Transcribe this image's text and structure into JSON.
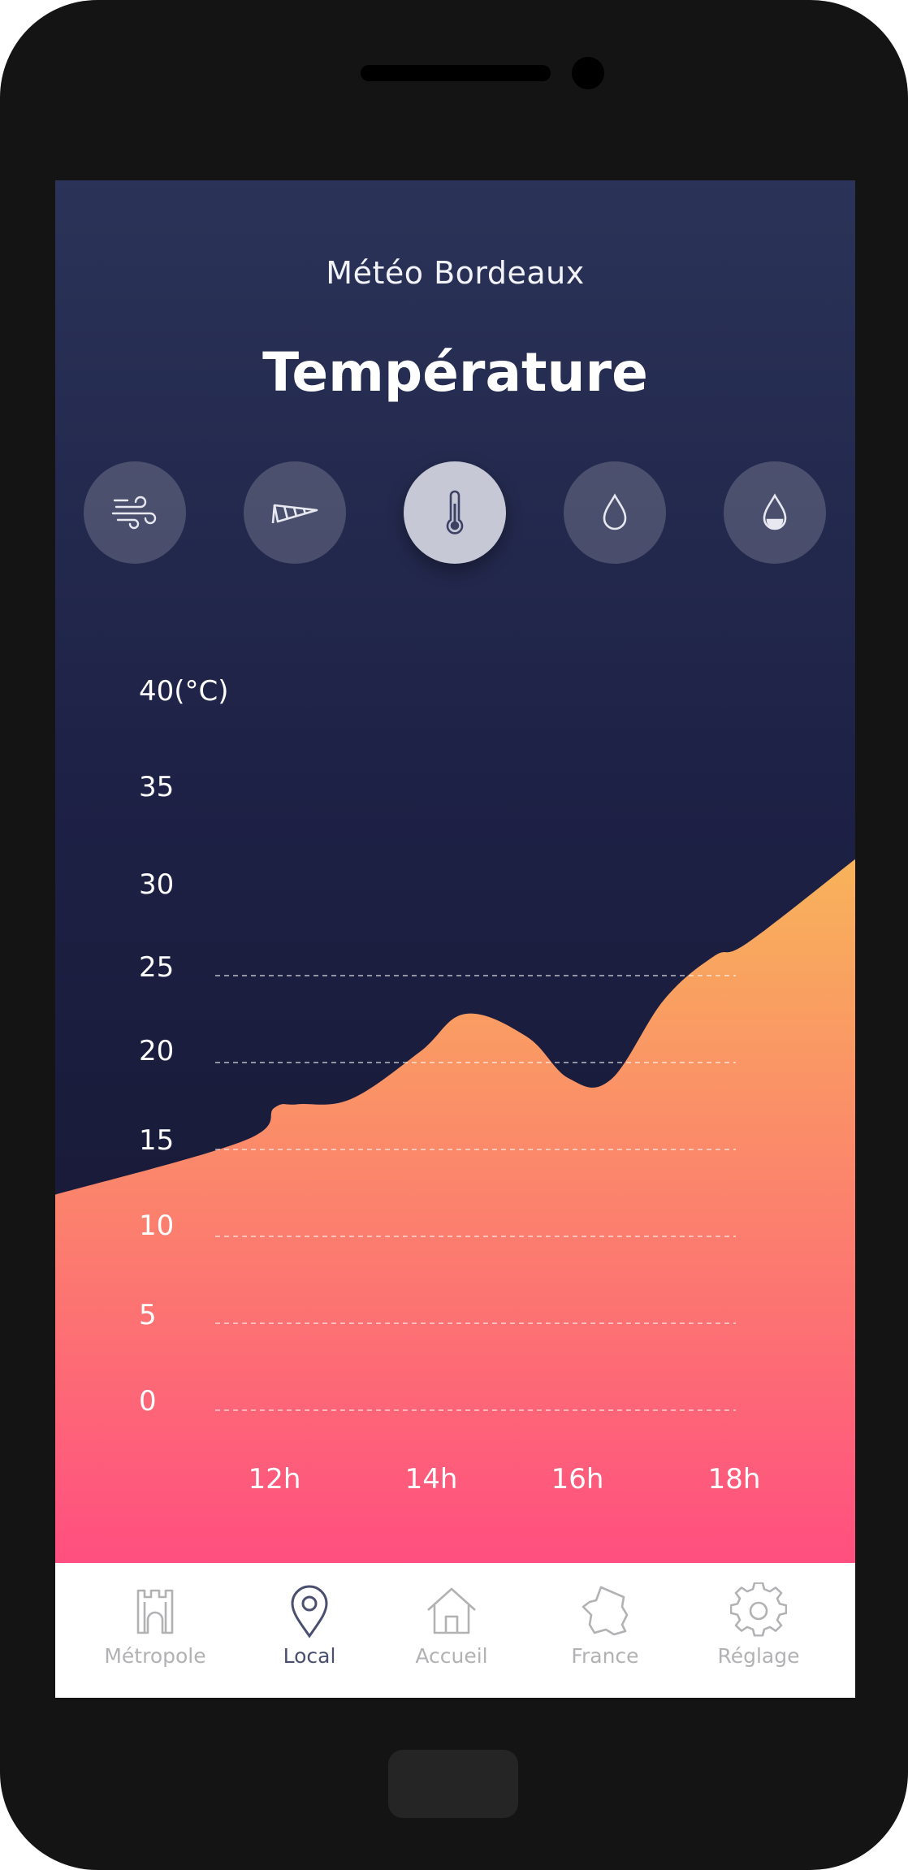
{
  "header": {
    "subtitle": "Météo Bordeaux",
    "title": "Température"
  },
  "categories": [
    {
      "icon": "wind-icon",
      "active": false
    },
    {
      "icon": "windsock-icon",
      "active": false
    },
    {
      "icon": "thermometer-icon",
      "active": true
    },
    {
      "icon": "raindrop-icon",
      "active": false
    },
    {
      "icon": "humidity-drop-icon",
      "active": false
    }
  ],
  "chart_data": {
    "type": "area",
    "title": "",
    "xlabel": "",
    "ylabel": "",
    "y_unit": "(°C)",
    "y_ticks": [
      0,
      5,
      10,
      15,
      20,
      25,
      30,
      35,
      40
    ],
    "y_tick_labels": [
      "0",
      "5",
      "10",
      "15",
      "20",
      "25",
      "30",
      "35",
      "40(°C)"
    ],
    "x_tick_labels": [
      "12h",
      "14h",
      "16h",
      "18h"
    ],
    "ylim": [
      0,
      40
    ],
    "grid": true,
    "grid_lines": [
      0,
      5,
      10,
      15,
      20,
      25
    ],
    "gradient_colors": [
      "#f8b35a",
      "#ff4f80"
    ],
    "x": [
      11.35,
      11.6,
      12,
      12.3,
      13,
      13.9,
      14.5,
      15.3,
      15.85,
      16.4,
      17.1,
      17.75,
      18.2,
      18.6
    ],
    "values": [
      12.4,
      15.5,
      17.4,
      17.6,
      17.9,
      20.6,
      22.8,
      21.5,
      19.1,
      19.0,
      23.6,
      26.1,
      26.9,
      31.7
    ]
  },
  "navbar": {
    "items": [
      {
        "label": "Métropole",
        "icon": "tower-icon",
        "active": false
      },
      {
        "label": "Local",
        "icon": "location-pin-icon",
        "active": true
      },
      {
        "label": "Accueil",
        "icon": "home-icon",
        "active": false
      },
      {
        "label": "France",
        "icon": "france-map-icon",
        "active": false
      },
      {
        "label": "Réglage",
        "icon": "gear-icon",
        "active": false
      }
    ]
  },
  "colors": {
    "background_top": "#2b3358",
    "background_bottom": "#181936",
    "nav_active": "#4a4f6f",
    "nav_inactive": "#b2b2b5"
  }
}
